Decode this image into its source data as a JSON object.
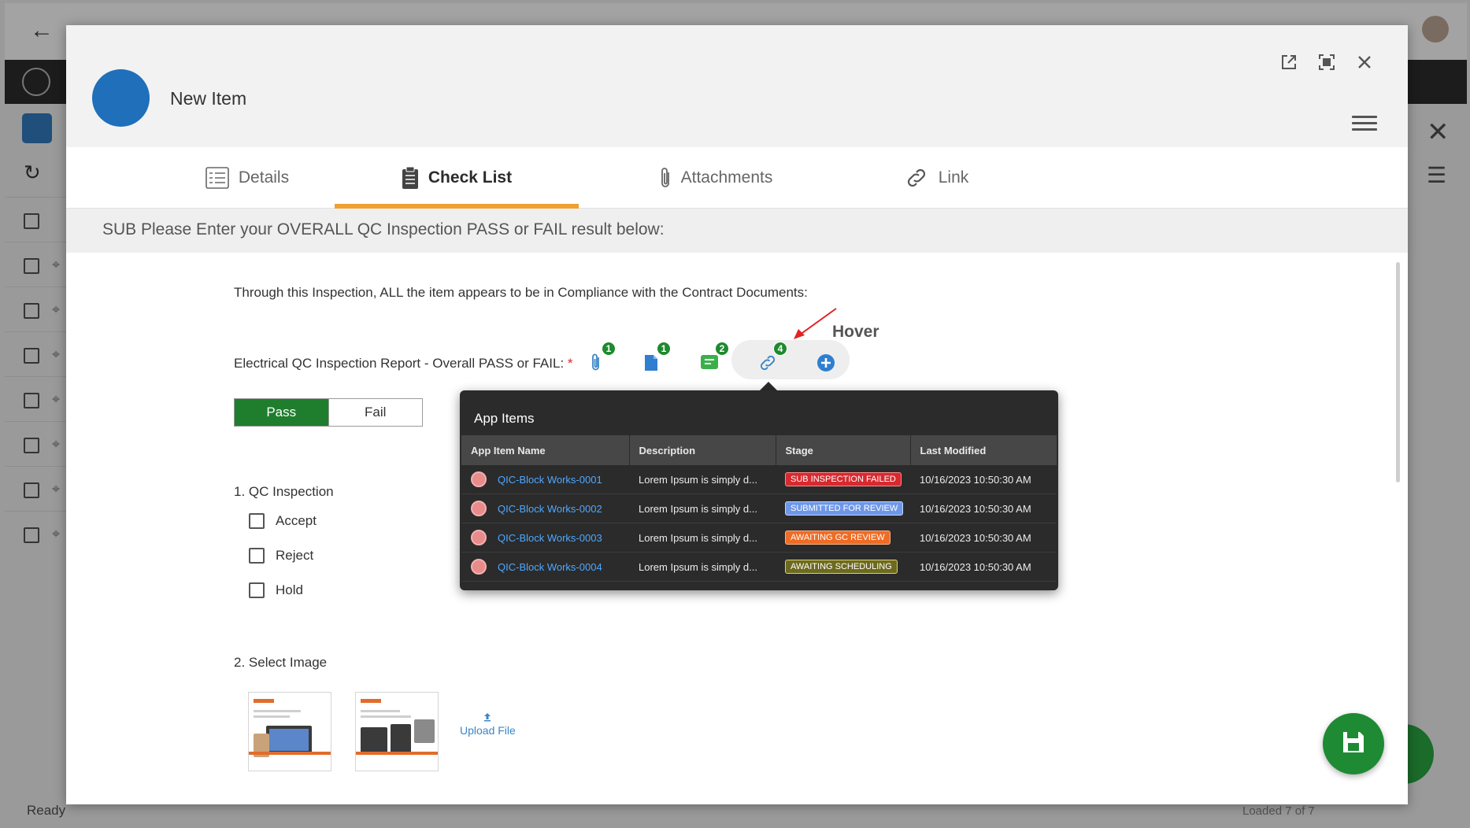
{
  "header": {
    "title": "New Item"
  },
  "tabs": [
    {
      "label": "Details",
      "icon": "list-icon"
    },
    {
      "label": "Check List",
      "icon": "clipboard-icon"
    },
    {
      "label": "Attachments",
      "icon": "paperclip-icon"
    },
    {
      "label": "Link",
      "icon": "link-icon"
    }
  ],
  "active_tab": "Check List",
  "section": {
    "heading": "SUB Please Enter your OVERALL QC Inspection PASS or FAIL result below:"
  },
  "compliance_text": "Through this Inspection, ALL the item appears to be in Compliance with the Contract Documents:",
  "question": {
    "label": "Electrical QC Inspection Report - Overall PASS or FAIL:",
    "required_mark": "*"
  },
  "counts": {
    "attachments": "1",
    "documents": "1",
    "comments": "2",
    "links": "4"
  },
  "hover_label": "Hover",
  "pass_fail": {
    "pass_label": "Pass",
    "fail_label": "Fail",
    "selected": "Pass"
  },
  "qc_inspection": {
    "title": "1. QC Inspection",
    "options": [
      "Accept",
      "Reject",
      "Hold"
    ]
  },
  "select_image": {
    "title": "2. Select Image",
    "upload_label": "Upload File"
  },
  "popover": {
    "title": "App Items",
    "columns": [
      "App Item Name",
      "Description",
      "Stage",
      "Last Modified"
    ],
    "rows": [
      {
        "name": "QIC-Block Works-0001",
        "description": "Lorem Ipsum is simply d...",
        "stage": "SUB INSPECTION FAILED",
        "modified": "10/16/2023  10:50:30 AM"
      },
      {
        "name": "QIC-Block Works-0002",
        "description": "Lorem Ipsum is simply d...",
        "stage": "SUBMITTED FOR REVIEW",
        "modified": "10/16/2023  10:50:30 AM"
      },
      {
        "name": "QIC-Block Works-0003",
        "description": "Lorem Ipsum is simply d...",
        "stage": "AWAITING GC REVIEW",
        "modified": "10/16/2023  10:50:30 AM"
      },
      {
        "name": "QIC-Block Works-0004",
        "description": "Lorem Ipsum is simply d...",
        "stage": "AWAITING SCHEDULING",
        "modified": "10/16/2023  10:50:30 AM"
      }
    ]
  },
  "background": {
    "status_text": "Ready",
    "loaded_text": "Loaded 7 of 7"
  },
  "colors": {
    "accent": "#f0a030",
    "pass": "#1e7e2e",
    "link": "#4ea8ff",
    "avatar": "#1f6fba"
  }
}
